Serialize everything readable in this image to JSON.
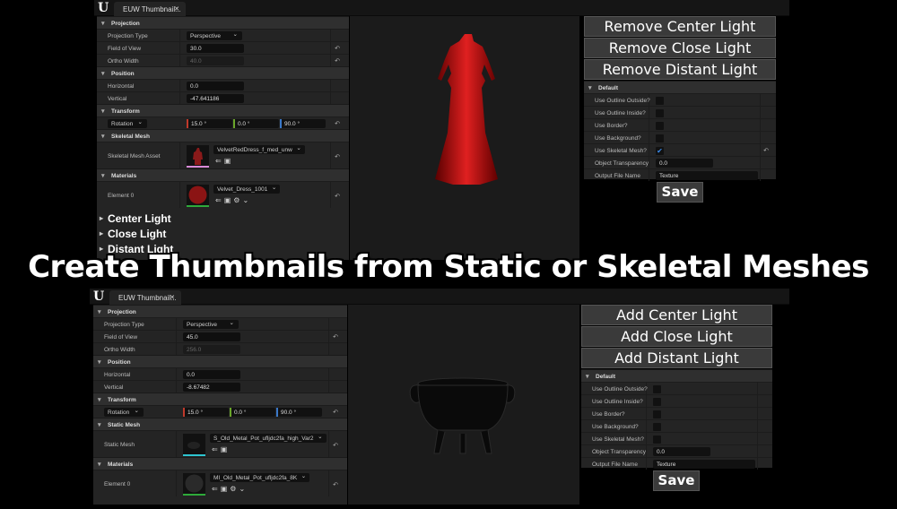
{
  "headline": "Create Thumbnails from Static or Skeletal Meshes",
  "colors": {
    "x_axis": "#c0392b",
    "y_axis": "#6aa52a",
    "z_axis": "#3a78c8",
    "checkbox": "#3b8bea",
    "skeletal_underline": "#d88ad8",
    "static_underline": "#2ec4d0",
    "material_underline": "#2eaa3a"
  },
  "top": {
    "tab_title": "EUW Thumbnail...",
    "projection": {
      "header": "Projection",
      "type_label": "Projection Type",
      "type_value": "Perspective",
      "fov_label": "Field of View",
      "fov_value": "30.0",
      "ortho_label": "Ortho Width",
      "ortho_value": "40.0"
    },
    "position": {
      "header": "Position",
      "h_label": "Horizontal",
      "h_value": "0.0",
      "v_label": "Vertical",
      "v_value": "-47.641186"
    },
    "transform": {
      "header": "Transform",
      "mode": "Rotation",
      "x": "15.0 °",
      "y": "0.0 °",
      "z": "90.0 °"
    },
    "mesh": {
      "header": "Skeletal Mesh",
      "label": "Skeletal Mesh Asset",
      "asset": "VelvetRedDress_f_med_unw"
    },
    "materials": {
      "header": "Materials",
      "label": "Element 0",
      "asset": "Velvet_Dress_1001"
    },
    "lights": [
      "Center Light",
      "Close Light",
      "Distant Light"
    ],
    "buttons": [
      "Remove Center Light",
      "Remove Close Light",
      "Remove Distant Light"
    ],
    "default": {
      "header": "Default",
      "rows": [
        {
          "label": "Use Outline Outside?",
          "checked": false
        },
        {
          "label": "Use Outline Inside?",
          "checked": false
        },
        {
          "label": "Use Border?",
          "checked": false
        },
        {
          "label": "Use Background?",
          "checked": false
        },
        {
          "label": "Use Skeletal Mesh?",
          "checked": true
        }
      ],
      "transparency_label": "Object Transparency",
      "transparency_value": "0.0",
      "filename_label": "Output File Name",
      "filename_value": "Texture"
    },
    "save": "Save"
  },
  "bottom": {
    "tab_title": "EUW Thumbnail...",
    "projection": {
      "header": "Projection",
      "type_label": "Projection Type",
      "type_value": "Perspective",
      "fov_label": "Field of View",
      "fov_value": "45.0",
      "ortho_label": "Ortho Width",
      "ortho_value": "256.0"
    },
    "position": {
      "header": "Position",
      "h_label": "Horizontal",
      "h_value": "0.0",
      "v_label": "Vertical",
      "v_value": "-8.67482"
    },
    "transform": {
      "header": "Transform",
      "mode": "Rotation",
      "x": "15.0 °",
      "y": "0.0 °",
      "z": "90.0 °"
    },
    "mesh": {
      "header": "Static Mesh",
      "label": "Static Mesh",
      "asset": "S_Old_Metal_Pot_ufljdc2fa_high_Var2"
    },
    "materials": {
      "header": "Materials",
      "label": "Element 0",
      "asset": "MI_Old_Metal_Pot_ufljdc2fa_8K"
    },
    "buttons": [
      "Add Center Light",
      "Add Close Light",
      "Add Distant Light"
    ],
    "default": {
      "header": "Default",
      "rows": [
        {
          "label": "Use Outline Outside?",
          "checked": false
        },
        {
          "label": "Use Outline Inside?",
          "checked": false
        },
        {
          "label": "Use Border?",
          "checked": false
        },
        {
          "label": "Use Background?",
          "checked": false
        },
        {
          "label": "Use Skeletal Mesh?",
          "checked": false
        }
      ],
      "transparency_label": "Object Transparency",
      "transparency_value": "0.0",
      "filename_label": "Output File Name",
      "filename_value": "Texture"
    },
    "save": "Save"
  }
}
